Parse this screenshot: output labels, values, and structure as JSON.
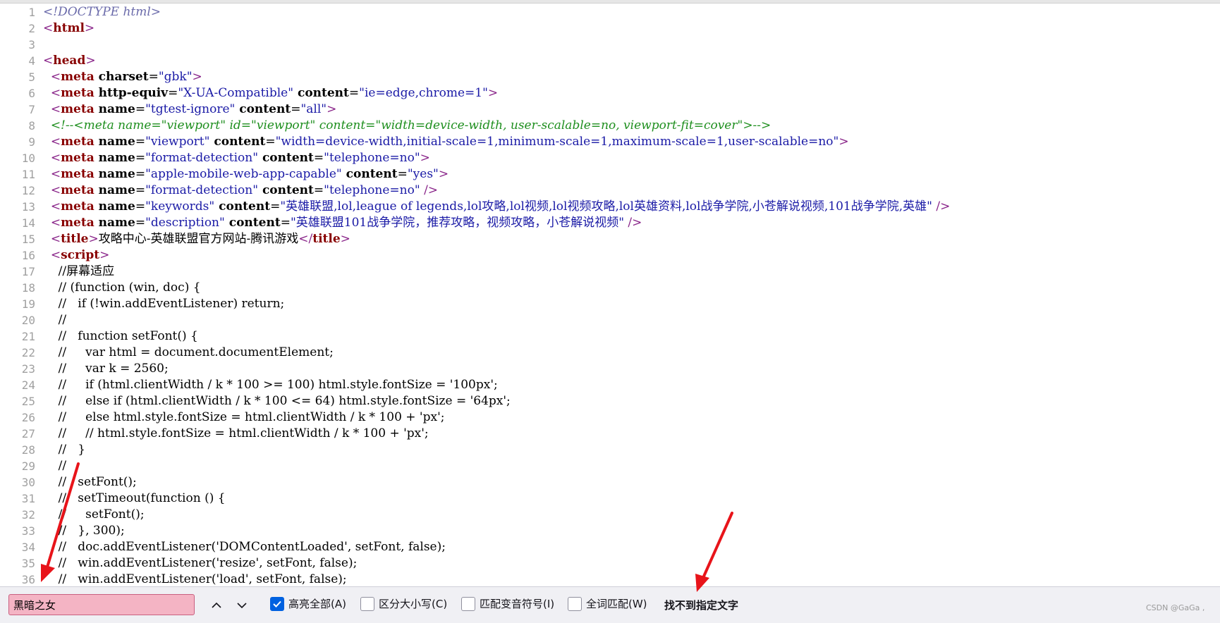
{
  "source_lines": [
    {
      "n": "1",
      "parts": [
        {
          "t": "<!DOCTYPE html>",
          "c": "doctype"
        }
      ]
    },
    {
      "n": "2",
      "parts": [
        {
          "t": "<",
          "c": "tag"
        },
        {
          "t": "html",
          "c": "tagname"
        },
        {
          "t": ">",
          "c": "tag"
        }
      ]
    },
    {
      "n": "3",
      "parts": []
    },
    {
      "n": "4",
      "parts": [
        {
          "t": "<",
          "c": "tag"
        },
        {
          "t": "head",
          "c": "tagname"
        },
        {
          "t": ">",
          "c": "tag"
        }
      ]
    },
    {
      "n": "5",
      "parts": [
        {
          "t": "  ",
          "c": ""
        },
        {
          "t": "<",
          "c": "tag"
        },
        {
          "t": "meta",
          "c": "tagname"
        },
        {
          "t": " charset",
          "c": "attr"
        },
        {
          "t": "=",
          "c": ""
        },
        {
          "t": "\"gbk\"",
          "c": "val"
        },
        {
          "t": ">",
          "c": "tag"
        }
      ]
    },
    {
      "n": "6",
      "parts": [
        {
          "t": "  ",
          "c": ""
        },
        {
          "t": "<",
          "c": "tag"
        },
        {
          "t": "meta",
          "c": "tagname"
        },
        {
          "t": " http-equiv",
          "c": "attr"
        },
        {
          "t": "=",
          "c": ""
        },
        {
          "t": "\"X-UA-Compatible\"",
          "c": "val"
        },
        {
          "t": " content",
          "c": "attr"
        },
        {
          "t": "=",
          "c": ""
        },
        {
          "t": "\"ie=edge,chrome=1\"",
          "c": "val"
        },
        {
          "t": ">",
          "c": "tag"
        }
      ]
    },
    {
      "n": "7",
      "parts": [
        {
          "t": "  ",
          "c": ""
        },
        {
          "t": "<",
          "c": "tag"
        },
        {
          "t": "meta",
          "c": "tagname"
        },
        {
          "t": " name",
          "c": "attr"
        },
        {
          "t": "=",
          "c": ""
        },
        {
          "t": "\"tgtest-ignore\"",
          "c": "val"
        },
        {
          "t": " content",
          "c": "attr"
        },
        {
          "t": "=",
          "c": ""
        },
        {
          "t": "\"all\"",
          "c": "val"
        },
        {
          "t": ">",
          "c": "tag"
        }
      ]
    },
    {
      "n": "8",
      "parts": [
        {
          "t": "  ",
          "c": ""
        },
        {
          "t": "<!--<meta name=\"viewport\" id=\"viewport\" content=\"width=device-width, user-scalable=no, viewport-fit=cover\">-->",
          "c": "comment"
        }
      ]
    },
    {
      "n": "9",
      "parts": [
        {
          "t": "  ",
          "c": ""
        },
        {
          "t": "<",
          "c": "tag"
        },
        {
          "t": "meta",
          "c": "tagname"
        },
        {
          "t": " name",
          "c": "attr"
        },
        {
          "t": "=",
          "c": ""
        },
        {
          "t": "\"viewport\"",
          "c": "val"
        },
        {
          "t": " content",
          "c": "attr"
        },
        {
          "t": "=",
          "c": ""
        },
        {
          "t": "\"width=device-width,initial-scale=1,minimum-scale=1,maximum-scale=1,user-scalable=no\"",
          "c": "val"
        },
        {
          "t": ">",
          "c": "tag"
        }
      ]
    },
    {
      "n": "10",
      "parts": [
        {
          "t": "  ",
          "c": ""
        },
        {
          "t": "<",
          "c": "tag"
        },
        {
          "t": "meta",
          "c": "tagname"
        },
        {
          "t": " name",
          "c": "attr"
        },
        {
          "t": "=",
          "c": ""
        },
        {
          "t": "\"format-detection\"",
          "c": "val"
        },
        {
          "t": " content",
          "c": "attr"
        },
        {
          "t": "=",
          "c": ""
        },
        {
          "t": "\"telephone=no\"",
          "c": "val"
        },
        {
          "t": ">",
          "c": "tag"
        }
      ]
    },
    {
      "n": "11",
      "parts": [
        {
          "t": "  ",
          "c": ""
        },
        {
          "t": "<",
          "c": "tag"
        },
        {
          "t": "meta",
          "c": "tagname"
        },
        {
          "t": " name",
          "c": "attr"
        },
        {
          "t": "=",
          "c": ""
        },
        {
          "t": "\"apple-mobile-web-app-capable\"",
          "c": "val"
        },
        {
          "t": " content",
          "c": "attr"
        },
        {
          "t": "=",
          "c": ""
        },
        {
          "t": "\"yes\"",
          "c": "val"
        },
        {
          "t": ">",
          "c": "tag"
        }
      ]
    },
    {
      "n": "12",
      "parts": [
        {
          "t": "  ",
          "c": ""
        },
        {
          "t": "<",
          "c": "tag"
        },
        {
          "t": "meta",
          "c": "tagname"
        },
        {
          "t": " name",
          "c": "attr"
        },
        {
          "t": "=",
          "c": ""
        },
        {
          "t": "\"format-detection\"",
          "c": "val"
        },
        {
          "t": " content",
          "c": "attr"
        },
        {
          "t": "=",
          "c": ""
        },
        {
          "t": "\"telephone=no\"",
          "c": "val"
        },
        {
          "t": " />",
          "c": "tag"
        }
      ]
    },
    {
      "n": "13",
      "parts": [
        {
          "t": "  ",
          "c": ""
        },
        {
          "t": "<",
          "c": "tag"
        },
        {
          "t": "meta",
          "c": "tagname"
        },
        {
          "t": " name",
          "c": "attr"
        },
        {
          "t": "=",
          "c": ""
        },
        {
          "t": "\"keywords\"",
          "c": "val"
        },
        {
          "t": " content",
          "c": "attr"
        },
        {
          "t": "=",
          "c": ""
        },
        {
          "t": "\"英雄联盟,lol,league of legends,lol攻略,lol视频,lol视频攻略,lol英雄资料,lol战争学院,小苍解说视频,101战争学院,英雄\"",
          "c": "val"
        },
        {
          "t": " />",
          "c": "tag"
        }
      ]
    },
    {
      "n": "14",
      "parts": [
        {
          "t": "  ",
          "c": ""
        },
        {
          "t": "<",
          "c": "tag"
        },
        {
          "t": "meta",
          "c": "tagname"
        },
        {
          "t": " name",
          "c": "attr"
        },
        {
          "t": "=",
          "c": ""
        },
        {
          "t": "\"description\"",
          "c": "val"
        },
        {
          "t": " content",
          "c": "attr"
        },
        {
          "t": "=",
          "c": ""
        },
        {
          "t": "\"英雄联盟101战争学院，推荐攻略，视频攻略，小苍解说视频\"",
          "c": "val"
        },
        {
          "t": " />",
          "c": "tag"
        }
      ]
    },
    {
      "n": "15",
      "parts": [
        {
          "t": "  ",
          "c": ""
        },
        {
          "t": "<",
          "c": "tag"
        },
        {
          "t": "title",
          "c": "tagname"
        },
        {
          "t": ">",
          "c": "tag"
        },
        {
          "t": "攻略中心-英雄联盟官方网站-腾讯游戏",
          "c": ""
        },
        {
          "t": "</",
          "c": "tag"
        },
        {
          "t": "title",
          "c": "tagname"
        },
        {
          "t": ">",
          "c": "tag"
        }
      ]
    },
    {
      "n": "16",
      "parts": [
        {
          "t": "  ",
          "c": ""
        },
        {
          "t": "<",
          "c": "tag"
        },
        {
          "t": "script",
          "c": "tagname"
        },
        {
          "t": ">",
          "c": "tag"
        }
      ]
    },
    {
      "n": "17",
      "parts": [
        {
          "t": "    //屏幕适应",
          "c": ""
        }
      ]
    },
    {
      "n": "18",
      "parts": [
        {
          "t": "    // (function (win, doc) {",
          "c": ""
        }
      ]
    },
    {
      "n": "19",
      "parts": [
        {
          "t": "    //   if (!win.addEventListener) return;",
          "c": ""
        }
      ]
    },
    {
      "n": "20",
      "parts": [
        {
          "t": "    //",
          "c": ""
        }
      ]
    },
    {
      "n": "21",
      "parts": [
        {
          "t": "    //   function setFont() {",
          "c": ""
        }
      ]
    },
    {
      "n": "22",
      "parts": [
        {
          "t": "    //     var html = document.documentElement;",
          "c": ""
        }
      ]
    },
    {
      "n": "23",
      "parts": [
        {
          "t": "    //     var k = 2560;",
          "c": ""
        }
      ]
    },
    {
      "n": "24",
      "parts": [
        {
          "t": "    //     if (html.clientWidth / k * 100 >= 100) html.style.fontSize = '100px';",
          "c": ""
        }
      ]
    },
    {
      "n": "25",
      "parts": [
        {
          "t": "    //     else if (html.clientWidth / k * 100 <= 64) html.style.fontSize = '64px';",
          "c": ""
        }
      ]
    },
    {
      "n": "26",
      "parts": [
        {
          "t": "    //     else html.style.fontSize = html.clientWidth / k * 100 + 'px';",
          "c": ""
        }
      ]
    },
    {
      "n": "27",
      "parts": [
        {
          "t": "    //     // html.style.fontSize = html.clientWidth / k * 100 + 'px';",
          "c": ""
        }
      ]
    },
    {
      "n": "28",
      "parts": [
        {
          "t": "    //   }",
          "c": ""
        }
      ]
    },
    {
      "n": "29",
      "parts": [
        {
          "t": "    //",
          "c": ""
        }
      ]
    },
    {
      "n": "30",
      "parts": [
        {
          "t": "    //   setFont();",
          "c": ""
        }
      ]
    },
    {
      "n": "31",
      "parts": [
        {
          "t": "    //   setTimeout(function () {",
          "c": ""
        }
      ]
    },
    {
      "n": "32",
      "parts": [
        {
          "t": "    //     setFont();",
          "c": ""
        }
      ]
    },
    {
      "n": "33",
      "parts": [
        {
          "t": "    //   }, 300);",
          "c": ""
        }
      ]
    },
    {
      "n": "34",
      "parts": [
        {
          "t": "    //   doc.addEventListener('DOMContentLoaded', setFont, false);",
          "c": ""
        }
      ]
    },
    {
      "n": "35",
      "parts": [
        {
          "t": "    //   win.addEventListener('resize', setFont, false);",
          "c": ""
        }
      ]
    },
    {
      "n": "36",
      "parts": [
        {
          "t": "    //   win.addEventListener('load', setFont, false);",
          "c": ""
        }
      ]
    }
  ],
  "find_bar": {
    "search_value": "黑暗之女",
    "previous_icon": "chevron-up-icon",
    "next_icon": "chevron-down-icon",
    "highlight_all": {
      "label": "高亮全部(A)",
      "checked": true
    },
    "match_case": {
      "label": "区分大小写(C)",
      "checked": false
    },
    "match_diacritics": {
      "label": "匹配变音符号(I)",
      "checked": false
    },
    "whole_words": {
      "label": "全词匹配(W)",
      "checked": false
    },
    "status": "找不到指定文字",
    "accent_color": "#0061e0",
    "not_found_color": "#f4b4c4"
  },
  "watermark": "CSDN @GaGa ,"
}
